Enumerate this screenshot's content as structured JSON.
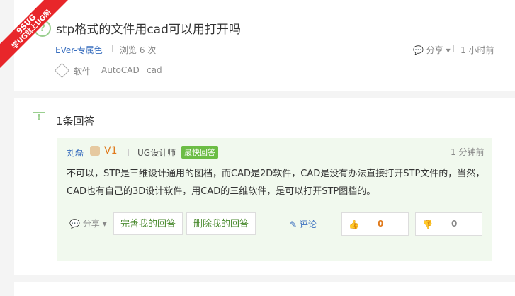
{
  "corner_badge": {
    "line1": "9SUG",
    "line2": "学UG就上UG网"
  },
  "question": {
    "title": "stp格式的文件用cad可以用打开吗",
    "author": "EVer-专属色",
    "views": "浏览 6 次",
    "share": "分享",
    "time": "1 小时前",
    "tags": [
      "软件",
      "AutoCAD",
      "cad"
    ]
  },
  "answers": {
    "count_label": "1条回答",
    "items": [
      {
        "author": "刘磊",
        "level": "V1",
        "role": "UG设计师",
        "badge": "最快回答",
        "time": "1 分钟前",
        "text": "不可以，STP是三维设计通用的图档，而CAD是2D软件，CAD是没有办法直接打开STP文件的，当然，CAD也有自己的3D设计软件，用CAD的三维软件，是可以打开STP图档的。",
        "share": "分享",
        "complete_button": "完善我的回答",
        "delete_button": "删除我的回答",
        "comment": "评论",
        "up_count": "0",
        "down_count": "0"
      }
    ]
  }
}
